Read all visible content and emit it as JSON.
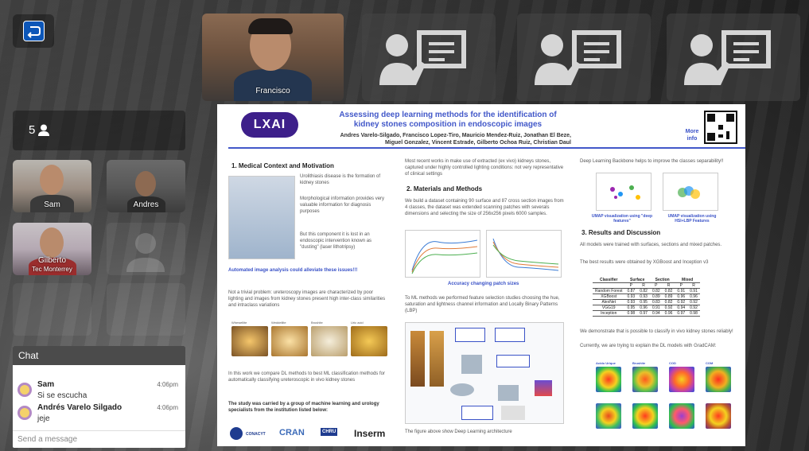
{
  "participants": {
    "count": "5",
    "top_tile_name": "Francisco",
    "tiles": [
      {
        "name": "Sam"
      },
      {
        "name": "Andres"
      },
      {
        "name": "Gilberto",
        "subtitle": "Tec Monterrey"
      }
    ]
  },
  "chat": {
    "title": "Chat",
    "messages": [
      {
        "sender": "Sam",
        "text": "Si se escucha",
        "time": "4:06pm"
      },
      {
        "sender": "Andrés Varelo Silgado",
        "text": "jeje",
        "time": "4:06pm"
      }
    ],
    "input_placeholder": "Send a message"
  },
  "poster": {
    "logo": "LXAI",
    "title": "Assessing deep learning methods for the identification of kidney stones composition in endoscopic images",
    "authors": "Andres Varelo-Silgado, Francisco Lopez-Tiro, Mauricio Mendez-Ruiz, Jonathan El Beze, Miguel Gonzalez, Vincent Estrade, Gilberto Ochoa Ruiz, Christian Daul",
    "more_info": "More info",
    "sections": {
      "s1": "1. Medical Context and Motivation",
      "s2": "2. Materials and Methods",
      "s3": "3. Results and Discussion"
    },
    "text": {
      "urolithiasis": "Urolithiasis disease is the formation of kidney stones",
      "morpho": "Morphological information provides very valuable information for diagnosis purposes",
      "lost": "But this component it is lost in an endoscopic intervention known as \"dusting\" (laser lithotripsy)",
      "automated": "Automated image analysis could alleviate these issues!!!",
      "trivial": "Not a trivial problem: ureteroscopy images are characterized by poor lighting and images from kidney stones present high inter-class similarities and intraclass variations",
      "compare": "In this work we compare DL methods to best ML classification methods for automatically classifying ureteroscopic in vivo kidney stones",
      "study": "The study was carried by a group of machine learning and urology specialists from the institution listed below:",
      "recent": "Most recent works in make use of extracted (ex vivo) kidneys stones, captured under highly controlled lighting conditions: not very representative of clinical settings",
      "dataset": "We build a dataset containing 90 surface and 87 cross section images from 4 classes, the dataset was extended scanning patches with severals dimensions and selecting the size of 256x256 pixels 6000 samples.",
      "accuracy_caption": "Accuracy changing patch sizes",
      "ml": "To ML methods we performed feature selection studies choosing the hue, saturation and lightness channel information and Locally Binary Patterns (LBP)",
      "fig_caption": "The figure above show Deep Learning architecture",
      "backbone": "Deep Learning Backbone helps to improve the classes separability!!",
      "umap1": "UMAP visualization using \"deep features\"",
      "umap2": "UMAP visualization using HSI+LBP Features",
      "trained": "All models were trained with surfaces, sections and mixed patches.",
      "best": "The best results were obtained by XGBoost and Inception v3",
      "demonstrate": "We demonstrate that is possible to classify in vivo kidney stones reliably!",
      "currently": "Currently, we are trying to explain the DL models with GradCAM:"
    },
    "table": {
      "head": [
        "Classifier",
        "Surface",
        "Section",
        "Mixed"
      ],
      "sub": [
        "",
        "P",
        "R",
        "P",
        "R",
        "P",
        "R"
      ],
      "rows": [
        [
          "Random Forest",
          "0.87",
          "0.82",
          "0.82",
          "0.82",
          "0.91",
          "0.91"
        ],
        [
          "XGBoost",
          "0.93",
          "0.93",
          "0.89",
          "0.89",
          "0.96",
          "0.96"
        ],
        [
          "AlexNet",
          "0.93",
          "0.95",
          "0.83",
          "0.82",
          "0.92",
          "0.92"
        ],
        [
          "VGG19",
          "0.95",
          "0.96",
          "0.91",
          "0.92",
          "0.94",
          "0.92"
        ],
        [
          "Inception",
          "0.98",
          "0.97",
          "0.94",
          "0.96",
          "0.97",
          "0.98"
        ]
      ]
    },
    "stone_labels": [
      "Whewellite",
      "Weddellite",
      "Brushite",
      "Uric acid"
    ],
    "gradcam_labels": [
      "Acido Urique",
      "Brushite",
      "COD",
      "COM"
    ],
    "partners": [
      "CONACYT",
      "CRAN",
      "CHRU",
      "Inserm"
    ]
  }
}
